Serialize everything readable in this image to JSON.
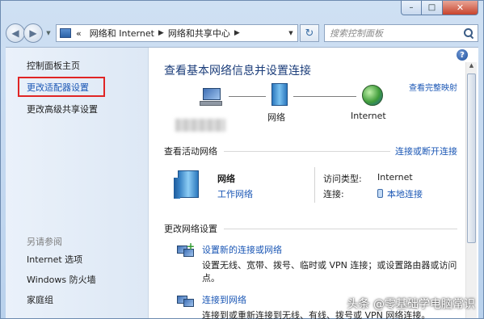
{
  "window": {
    "caption": {
      "minimize": "–",
      "maximize": "□",
      "close": "✕"
    }
  },
  "navbar": {
    "back_glyph": "◀",
    "forward_glyph": "▶",
    "dropdown_glyph": "▼",
    "address": {
      "overflow": "«",
      "crumbs": [
        "网络和 Internet",
        "网络和共享中心"
      ],
      "separator": "▶",
      "dropdown_glyph": "▼"
    },
    "refresh_glyph": "↻",
    "search_placeholder": "搜索控制面板",
    "search_icon": "search-icon"
  },
  "sidebar": {
    "items": [
      "控制面板主页",
      "更改适配器设置",
      "更改高级共享设置"
    ],
    "see_also_label": "另请参阅",
    "see_also": [
      "Internet 选项",
      "Windows 防火墙",
      "家庭组"
    ]
  },
  "main": {
    "help": "?",
    "title": "查看基本网络信息并设置连接",
    "view_full_map": "查看完整映射",
    "topology": {
      "nodes": [
        {
          "icon": "computer-icon",
          "label": ""
        },
        {
          "icon": "network-icon",
          "label": "网络"
        },
        {
          "icon": "globe-icon",
          "label": "Internet"
        }
      ]
    },
    "active": {
      "heading": "查看活动网络",
      "action": "连接或断开连接",
      "network_name": "网络",
      "network_type": "工作网络",
      "access_type_label": "访问类型:",
      "access_type_value": "Internet",
      "connections_label": "连接:",
      "connections_value": "本地连接"
    },
    "change": {
      "heading": "更改网络设置",
      "tasks": [
        {
          "icon": "new-connection-icon",
          "link": "设置新的连接或网络",
          "desc": "设置无线、宽带、拨号、临时或 VPN 连接；或设置路由器或访问点。"
        },
        {
          "icon": "connect-network-icon",
          "link": "连接到网络",
          "desc": "连接到或重新连接到无线、有线、拨号或 VPN 网络连接。"
        }
      ]
    }
  },
  "watermark": "头条 @零基础学电脑常识",
  "colors": {
    "link": "#1b57b5",
    "title": "#1b3d7a",
    "highlight_box": "#e02525"
  }
}
